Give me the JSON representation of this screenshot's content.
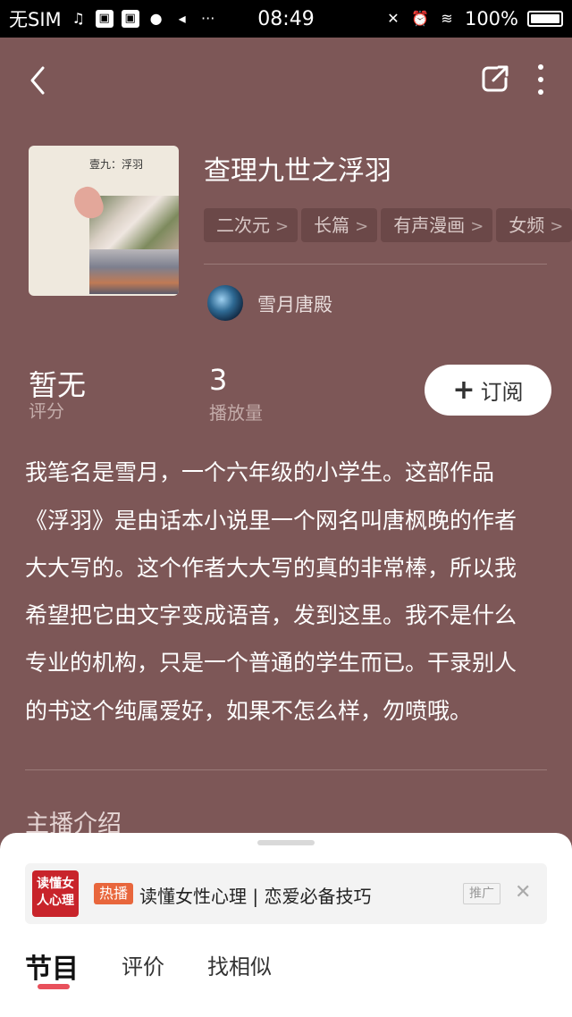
{
  "status_bar": {
    "carrier": "无SIM",
    "time": "08:49",
    "battery": "100%"
  },
  "book": {
    "title": "查理九世之浮羽",
    "cover_title": "壹九：浮羽",
    "tags": [
      "二次元",
      "长篇",
      "有声漫画",
      "女频"
    ],
    "tag_chevron": ">",
    "author": "雪月唐殿"
  },
  "stats": {
    "rating_value": "暂无",
    "rating_label": "评分",
    "plays_value": "3",
    "plays_label": "播放量"
  },
  "subscribe": {
    "plus": "+",
    "label": "订阅"
  },
  "description_lines": [
    "我笔名是雪月，一个六年级的小学生。这部作品",
    "《浮羽》是由话本小说里一个网名叫唐枫晚的作者",
    "大大写的。这个作者大大写的真的非常棒，所以我",
    "希望把它由文字变成语音，发到这里。我不是什么",
    "专业的机构，只是一个普通的学生而已。干录别人",
    "的书这个纯属爱好，如果不怎么样，勿喷哦。"
  ],
  "section": {
    "host_intro_title": "主播介绍"
  },
  "promo": {
    "logo_text": "读懂女人心理",
    "badge": "热播",
    "text": "读懂女性心理 | 恋爱必备技巧",
    "ad_label": "推广",
    "close": "✕"
  },
  "tabs": [
    {
      "label": "节目"
    },
    {
      "label": "评价"
    },
    {
      "label": "找相似"
    }
  ],
  "colors": {
    "background": "#7d5757",
    "accent": "#e8505b",
    "promo_badge": "#e8663c"
  }
}
